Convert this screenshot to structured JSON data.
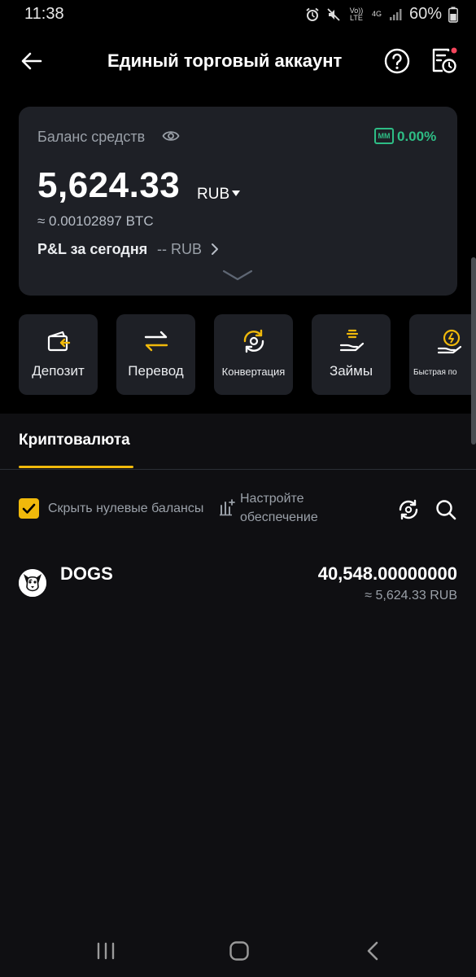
{
  "status_bar": {
    "time": "11:38",
    "network_volte": "Vo)) LTE",
    "network_4g": "4G",
    "battery": "60%"
  },
  "header": {
    "title": "Единый торговый аккаунт",
    "back_icon": "arrow-left-icon",
    "help_icon": "question-circle-icon",
    "history_icon": "document-clock-icon"
  },
  "balance": {
    "label": "Баланс средств",
    "mm_badge": "MM",
    "mm_value": "0.00%",
    "amount": "5,624.33",
    "currency": "RUB",
    "btc_equiv": "≈ 0.00102897 BTC",
    "pnl_label": "P&L за сегодня",
    "pnl_value": "-- RUB"
  },
  "actions": [
    {
      "label": "Депозит",
      "icon": "wallet-deposit-icon"
    },
    {
      "label": "Перевод",
      "icon": "transfer-arrows-icon"
    },
    {
      "label": "Конвертация",
      "icon": "convert-cycle-icon"
    },
    {
      "label": "Займы",
      "icon": "loan-hand-icon"
    },
    {
      "label": "Быстрая по",
      "icon": "flash-loan-icon"
    }
  ],
  "tabs": {
    "crypto": "Криптовалюта"
  },
  "filters": {
    "hide_zero_label": "Скрыть нулевые балансы",
    "hide_zero_checked": true,
    "collateral_label": "Настройте обеспечение"
  },
  "assets": [
    {
      "name": "DOGS",
      "amount": "40,548.00000000",
      "fiat": "≈ 5,624.33 RUB"
    }
  ],
  "colors": {
    "accent": "#f0b90b",
    "positive": "#2ebd85",
    "card_bg": "#1e2026"
  }
}
